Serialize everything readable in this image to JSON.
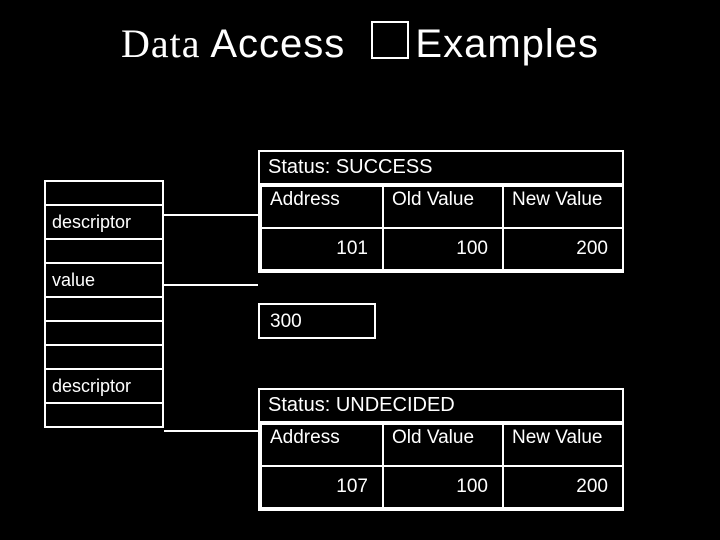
{
  "title": {
    "word1": "Data",
    "word2": "Access",
    "word3": "Examples"
  },
  "left_labels": {
    "descriptor1": "descriptor",
    "value": "value",
    "descriptor2": "descriptor"
  },
  "isolated_value": "300",
  "blocks": {
    "success": {
      "status_label": "Status:",
      "status_value": "SUCCESS",
      "headers": {
        "address": "Address",
        "old": "Old Value",
        "new": "New Value"
      },
      "row": {
        "address": "101",
        "old": "100",
        "new": "200"
      }
    },
    "undecided": {
      "status_label": "Status:",
      "status_value": "UNDECIDED",
      "headers": {
        "address": "Address",
        "old": "Old Value",
        "new": "New Value"
      },
      "row": {
        "address": "107",
        "old": "100",
        "new": "200"
      }
    }
  }
}
